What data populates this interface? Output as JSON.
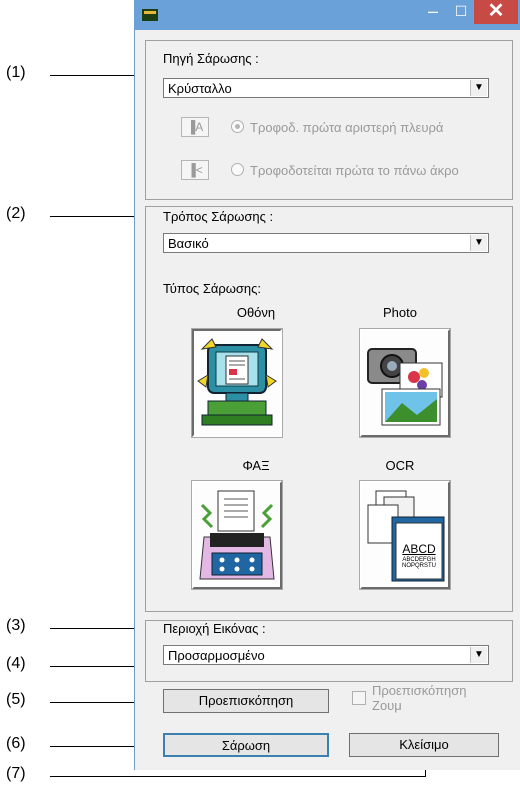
{
  "callouts": [
    "(1)",
    "(2)",
    "(3)",
    "(4)",
    "(5)",
    "(6)",
    "(7)"
  ],
  "titlebar": {
    "minimize": "–",
    "maximize": "☐",
    "close": "✕"
  },
  "scan_source": {
    "label": "Πηγή Σάρωσης :",
    "value": "Κρύσταλλο",
    "option1": "Τροφοδ. πρώτα αριστερή πλευρά",
    "option2": "Τροφοδοτείται πρώτα το πάνω άκρο",
    "icon1_glyph": "A",
    "icon2_glyph": "<"
  },
  "scan_mode": {
    "label": "Τρόπος Σάρωσης :",
    "value": "Βασικό",
    "type_label": "Τύπος Σάρωσης:",
    "types": [
      "Οθόνη",
      "Photo",
      "ΦΑΞ",
      "OCR"
    ]
  },
  "image_area": {
    "label": "Περιοχή Εικόνας :",
    "value": "Προσαρμοσμένο"
  },
  "buttons": {
    "preview": "Προεπισκόπηση",
    "zoom_preview_line1": "Προεπισκόπηση",
    "zoom_preview_line2": "Ζουμ",
    "scan": "Σάρωση",
    "close": "Κλείσιμο"
  },
  "ocr_sample": [
    "ABCD",
    "ABCDEFGH",
    "NOPQRSTU"
  ],
  "colors": {
    "titlebar": "#6aa1d8",
    "close": "#c74a45",
    "focus": "#3c7fb1"
  }
}
